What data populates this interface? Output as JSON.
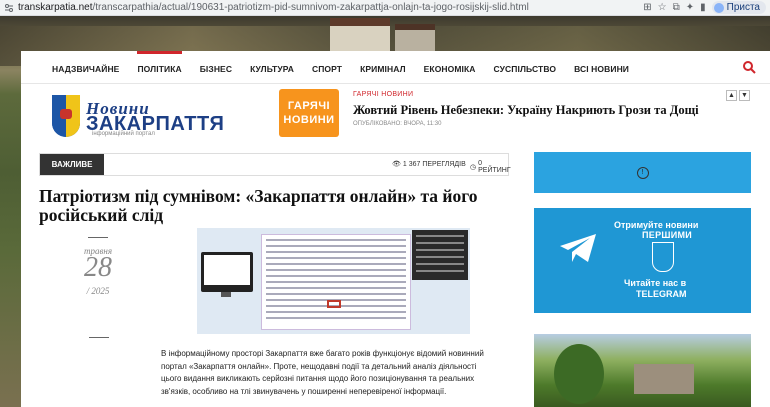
{
  "browser": {
    "url_host": "transkarpatia.net",
    "url_path": "/transcarpathia/actual/190631-patriotizm-pid-sumnivom-zakarpattja-onlajn-ta-jogo-rosijskij-slid.html",
    "profile_label": "Приста"
  },
  "nav": {
    "items": [
      "НАДЗВИЧАЙНЕ",
      "ПОЛІТИКА",
      "БІЗНЕС",
      "КУЛЬТУРА",
      "СПОРТ",
      "КРИМІНАЛ",
      "ЕКОНОМІКА",
      "СУСПІЛЬСТВО",
      "ВСІ НОВИНИ"
    ],
    "active_index": 1
  },
  "logo": {
    "line1": "Новини",
    "line2": "ЗАКАРПАТТЯ",
    "tagline": "інформаційний портал"
  },
  "hot": {
    "box_line1": "ГАРЯЧІ",
    "box_line2": "НОВИНИ",
    "category": "ГАРЯЧІ НОВИНИ",
    "title": "Жовтий Рівень Небезпеки: Україну Накриють Грози та Дощі",
    "meta": "ОПУБЛІКОВАНО: ВЧОРА, 11:30"
  },
  "article": {
    "tag": "ВАЖЛИВЕ",
    "views": "1 367 ПЕРЕГЛЯДІВ",
    "rating": "0 РЕЙТИНГ",
    "title": "Патріотизм під сумнівом: «Закарпаття онлайн» та його російський слід",
    "date_month": "травня",
    "date_day": "28",
    "date_year": "/ 2025",
    "body": "В інформаційному просторі Закарпаття вже багато років функціонує відомий новинний портал «Закарпаття онлайн». Проте, нещодавні події та детальний аналіз діяльності цього видання викликають серйозні питання щодо його позиціонування та реальних зв'язків, особливо на тлі звинувачень у поширенні неперевіреної інформації."
  },
  "telegram": {
    "line1": "Отримуйте новини",
    "line2": "ПЕРШИМИ",
    "line3": "Читайте нас в",
    "line4": "TELEGRAM"
  },
  "colors": {
    "accent": "#d0262c",
    "hot": "#f7941d",
    "telegram": "#1f97d4"
  }
}
